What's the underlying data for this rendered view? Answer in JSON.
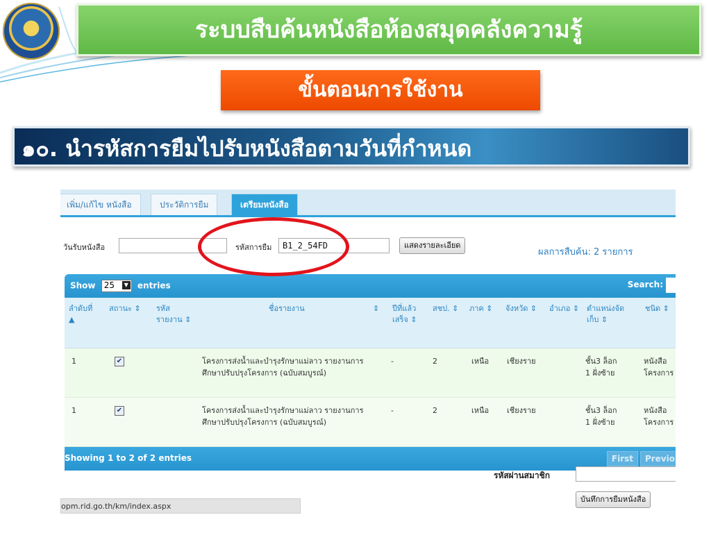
{
  "slide": {
    "title": "ระบบสืบค้นหนังสือห้องสมุดคลังความรู้",
    "subtitle": "ขั้นตอนการใช้งาน",
    "step": "๑๐. นำรหัสการยืมไปรับหนังสือตามวันที่กำหนด",
    "logo": "agency-seal-logo"
  },
  "tabs": [
    {
      "label": "เพิ่ม/แก้ไข หนังสือ",
      "active": false
    },
    {
      "label": "ประวัติการยืม",
      "active": false
    },
    {
      "label": "เตรียมหนังสือ",
      "active": true
    }
  ],
  "form": {
    "receive_date_label": "วันรับหนังสือ",
    "receive_date_value": "",
    "borrow_code_label": "รหัสการยืม",
    "borrow_code_value": "B1_2_54FD",
    "show_detail_button": "แสดงรายละเอียด",
    "result_text": "ผลการสืบค้น: 2 รายการ"
  },
  "table": {
    "show_label": "Show",
    "entries_value": "25",
    "entries_label": "entries",
    "search_label": "Search:",
    "columns": [
      "ลำดับที่",
      "สถานะ",
      "รหัสรายงาน",
      "ชื่อรายงาน",
      "ปีที่แล้วเสร็จ",
      "สชป.",
      "ภาค",
      "จังหวัด",
      "อำเภอ",
      "ตำแหน่งจัดเก็บ",
      "ชนิด"
    ],
    "rows": [
      {
        "no": "1",
        "checked": true,
        "code": "",
        "name_line1": "โครงการส่งน้ำและบำรุงรักษาแม่ลาว รายงานการ",
        "name_line2": "ศึกษาปรับปรุงโครงการ (ฉบับสมบูรณ์)",
        "year": "-",
        "office": "2",
        "region": "เหนือ",
        "province": "เชียงราย",
        "district": "",
        "loc_line1": "ชั้น3 ล็อก",
        "loc_line2": "1 ฝั่งซ้าย",
        "type_line1": "หนังสือ",
        "type_line2": "โครงการ"
      },
      {
        "no": "1",
        "checked": true,
        "code": "",
        "name_line1": "โครงการส่งน้ำและบำรุงรักษาแม่ลาว รายงานการ",
        "name_line2": "ศึกษาปรับปรุงโครงการ (ฉบับสมบูรณ์)",
        "year": "-",
        "office": "2",
        "region": "เหนือ",
        "province": "เชียงราย",
        "district": "",
        "loc_line1": "ชั้น3 ล็อก",
        "loc_line2": "1 ฝั่งซ้าย",
        "type_line1": "หนังสือ",
        "type_line2": "โครงการ"
      }
    ],
    "footer_info": "Showing 1 to 2 of 2 entries",
    "first_button": "First",
    "prev_button": "Previo"
  },
  "member": {
    "password_label": "รหัสผ่านสมาชิก",
    "password_value": "",
    "save_button": "บันทึกการยืมหนังสือ"
  },
  "status_url": "opm.rid.go.th/km/index.aspx",
  "colors": {
    "title_green": "#6cc353",
    "subtitle_orange": "#f55a0a",
    "step_navy": "#0a2d57",
    "table_blue": "#2ea2db",
    "highlight_red": "#e2141c"
  }
}
